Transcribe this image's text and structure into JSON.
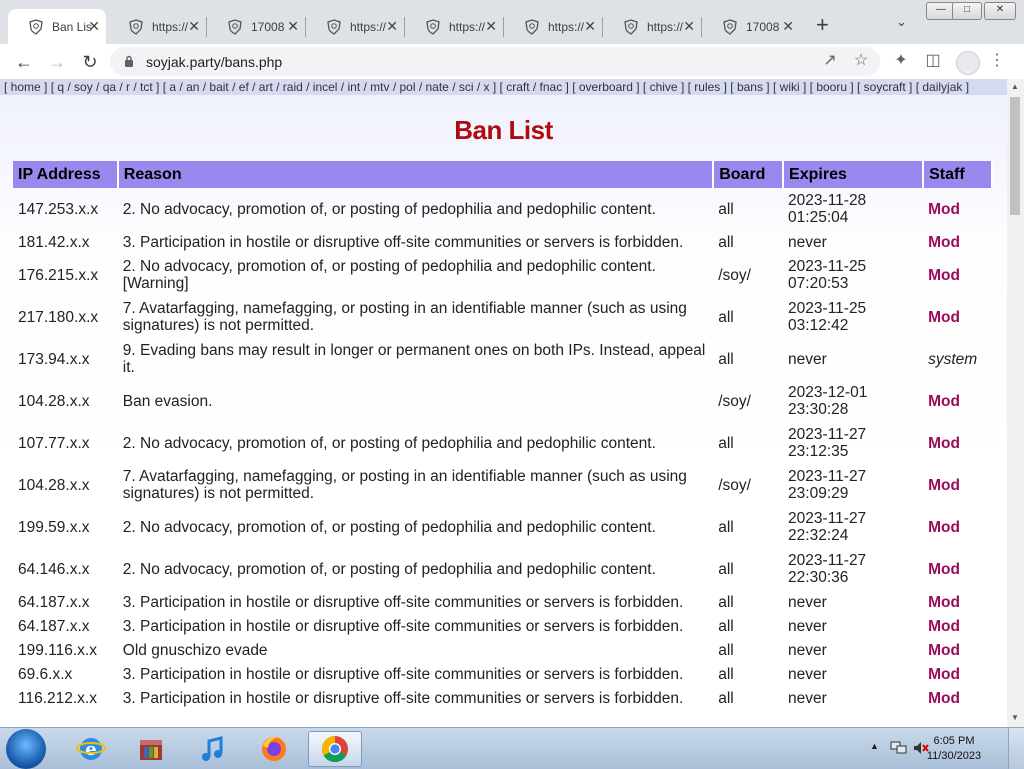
{
  "browser": {
    "tabs": [
      {
        "title": "Ban List",
        "active": true
      },
      {
        "title": "https://"
      },
      {
        "title": "17008"
      },
      {
        "title": "https://"
      },
      {
        "title": "https://"
      },
      {
        "title": "https://"
      },
      {
        "title": "https://"
      },
      {
        "title": "17008"
      }
    ],
    "url": "soyjak.party/bans.php"
  },
  "boardlist": "[ home ] [ q / soy / qa / r / tct ] [ a / an / bait / ef / art / raid / incel / int / mtv / pol / nate / sci / x ] [ craft / fnac ] [ overboard ] [ chive ] [ rules ] [ bans ] [ wiki ] [ booru ] [ soycraft ] [ dailyjak ]",
  "page": {
    "title": "Ban List",
    "columns": [
      "IP Address",
      "Reason",
      "Board",
      "Expires",
      "Staff"
    ],
    "rows": [
      {
        "ip": "147.253.x.x",
        "reason": "2. No advocacy, promotion of, or posting of pedophilia and pedophilic content.",
        "board": "all",
        "expires": "2023-11-28 01:25:04",
        "staff": "Mod"
      },
      {
        "ip": "181.42.x.x",
        "reason": "3. Participation in hostile or disruptive off-site communities or servers is forbidden.",
        "board": "all",
        "expires": "never",
        "staff": "Mod"
      },
      {
        "ip": "176.215.x.x",
        "reason": "2. No advocacy, promotion of, or posting of pedophilia and pedophilic content. [Warning]",
        "board": "/soy/",
        "expires": "2023-11-25 07:20:53",
        "staff": "Mod"
      },
      {
        "ip": "217.180.x.x",
        "reason": "7. Avatarfagging, namefagging, or posting in an identifiable manner (such as using signatures) is not permitted.",
        "board": "all",
        "expires": "2023-11-25 03:12:42",
        "staff": "Mod"
      },
      {
        "ip": "173.94.x.x",
        "reason": "9. Evading bans may result in longer or permanent ones on both IPs. Instead, appeal it.",
        "board": "all",
        "expires": "never",
        "staff": "system"
      },
      {
        "ip": "104.28.x.x",
        "reason": "Ban evasion.",
        "board": "/soy/",
        "expires": "2023-12-01 23:30:28",
        "staff": "Mod"
      },
      {
        "ip": "107.77.x.x",
        "reason": "2. No advocacy, promotion of, or posting of pedophilia and pedophilic content.",
        "board": "all",
        "expires": "2023-11-27 23:12:35",
        "staff": "Mod"
      },
      {
        "ip": "104.28.x.x",
        "reason": "7. Avatarfagging, namefagging, or posting in an identifiable manner (such as using signatures) is not permitted.",
        "board": "/soy/",
        "expires": "2023-11-27 23:09:29",
        "staff": "Mod"
      },
      {
        "ip": "199.59.x.x",
        "reason": "2. No advocacy, promotion of, or posting of pedophilia and pedophilic content.",
        "board": "all",
        "expires": "2023-11-27 22:32:24",
        "staff": "Mod"
      },
      {
        "ip": "64.146.x.x",
        "reason": "2. No advocacy, promotion of, or posting of pedophilia and pedophilic content.",
        "board": "all",
        "expires": "2023-11-27 22:30:36",
        "staff": "Mod"
      },
      {
        "ip": "64.187.x.x",
        "reason": "3. Participation in hostile or disruptive off-site communities or servers is forbidden.",
        "board": "all",
        "expires": "never",
        "staff": "Mod"
      },
      {
        "ip": "64.187.x.x",
        "reason": "3. Participation in hostile or disruptive off-site communities or servers is forbidden.",
        "board": "all",
        "expires": "never",
        "staff": "Mod"
      },
      {
        "ip": "199.116.x.x",
        "reason": "Old gnuschizo evade",
        "board": "all",
        "expires": "never",
        "staff": "Mod"
      },
      {
        "ip": "69.6.x.x",
        "reason": "3. Participation in hostile or disruptive off-site communities or servers is forbidden.",
        "board": "all",
        "expires": "never",
        "staff": "Mod"
      },
      {
        "ip": "116.212.x.x",
        "reason": "3. Participation in hostile or disruptive off-site communities or servers is forbidden.",
        "board": "all",
        "expires": "never",
        "staff": "Mod"
      }
    ]
  },
  "taskbar": {
    "time": "6:05 PM",
    "date": "11/30/2023"
  },
  "colors": {
    "heading": "#af0a0f",
    "header_bg": "#9988ee",
    "staff_mod": "#9b0b59",
    "boardlist_bg": "#d6daf0"
  }
}
